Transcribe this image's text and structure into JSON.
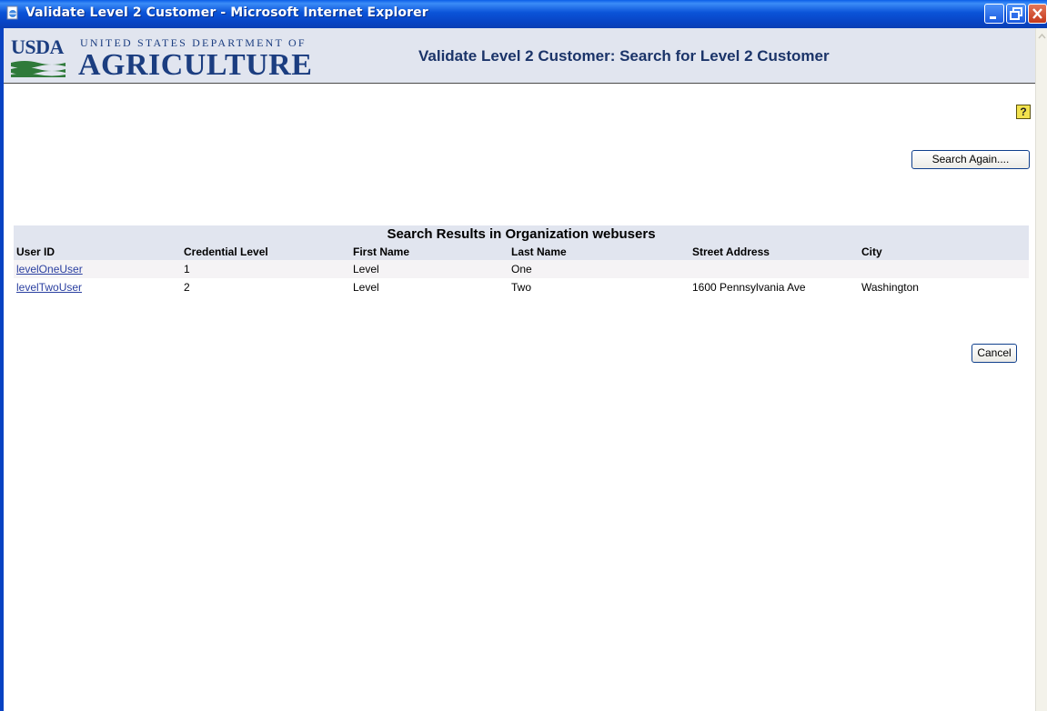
{
  "window": {
    "title": "Validate Level 2 Customer - Microsoft Internet Explorer"
  },
  "header": {
    "logo_usda": "USDA",
    "logo_department": "UNITED STATES DEPARTMENT OF",
    "logo_agriculture": "AGRICULTURE",
    "page_title": "Validate Level 2 Customer: Search for Level 2 Customer"
  },
  "toolbar": {
    "help_label": "?",
    "search_again_label": "Search Again....",
    "cancel_label": "Cancel"
  },
  "results": {
    "title": "Search Results in Organization webusers",
    "columns": [
      "User ID",
      "Credential Level",
      "First Name",
      "Last Name",
      "Street Address",
      "City"
    ],
    "rows": [
      {
        "user_id": "levelOneUser",
        "credential_level": "1",
        "first_name": "Level",
        "last_name": "One",
        "street_address": "",
        "city": ""
      },
      {
        "user_id": "levelTwoUser",
        "credential_level": "2",
        "first_name": "Level",
        "last_name": "Two",
        "street_address": "1600 Pennsylvania Ave",
        "city": "Washington"
      }
    ]
  },
  "colors": {
    "header_band": "#e1e5ef",
    "heading_text": "#1b3469",
    "link": "#2a3fa0",
    "titlebar": "#0a53d8"
  },
  "icons": {
    "app": "ie-page-icon",
    "help": "help-question-icon",
    "minimize": "minimize-icon",
    "maximize": "restore-icon",
    "close": "close-icon"
  }
}
